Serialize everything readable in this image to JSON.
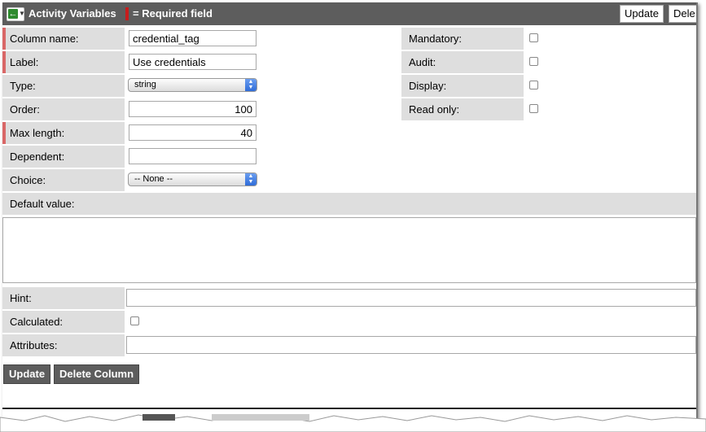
{
  "header": {
    "back_icon": "left-arrow-icon",
    "title": "Activity Variables",
    "required_legend": "= Required field",
    "update_label": "Update",
    "delete_label": "Dele"
  },
  "form": {
    "column_name": {
      "label": "Column name:",
      "value": "credential_tag",
      "required": true
    },
    "label": {
      "label": "Label:",
      "value": "Use credentials",
      "required": true
    },
    "type": {
      "label": "Type:",
      "selected": "string"
    },
    "order": {
      "label": "Order:",
      "value": "100"
    },
    "max_length": {
      "label": "Max length:",
      "value": "40",
      "required": true
    },
    "dependent": {
      "label": "Dependent:",
      "value": ""
    },
    "choice": {
      "label": "Choice:",
      "selected": "-- None --"
    },
    "mandatory": {
      "label": "Mandatory:",
      "checked": false
    },
    "audit": {
      "label": "Audit:",
      "checked": false
    },
    "display": {
      "label": "Display:",
      "checked": false
    },
    "read_only": {
      "label": "Read only:",
      "checked": false
    },
    "default_value": {
      "label": "Default value:",
      "value": ""
    },
    "hint": {
      "label": "Hint:",
      "value": ""
    },
    "calculated": {
      "label": "Calculated:",
      "checked": false
    },
    "attributes": {
      "label": "Attributes:",
      "value": ""
    }
  },
  "actions": {
    "update_label": "Update",
    "delete_column_label": "Delete Column"
  },
  "colors": {
    "header_bg": "#5d5d5d",
    "label_bg": "#dedede",
    "required_marker": "#d96767",
    "legend_marker": "#c81c1c"
  }
}
